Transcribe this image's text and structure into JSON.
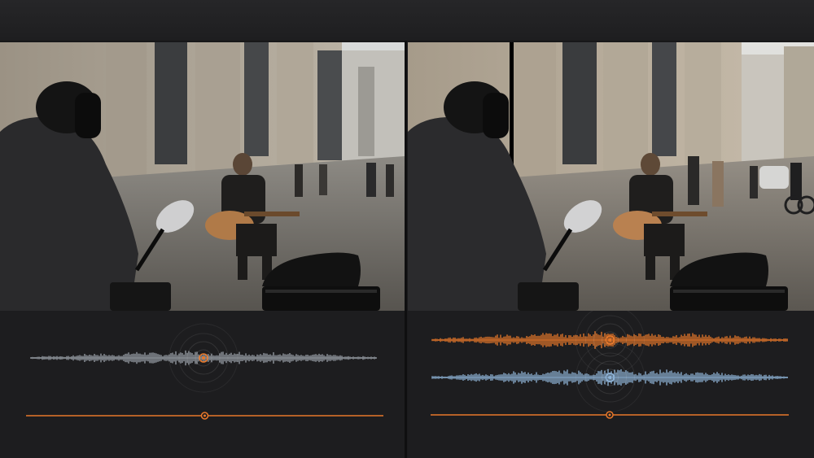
{
  "colors": {
    "background": "#1b1b1d",
    "topbar": "#232325",
    "accent_orange": "#e8782a",
    "wave_grey": "#9aa0a8",
    "wave_blue": "#8fb4d8"
  },
  "panels": [
    {
      "id": "before",
      "preview": "busker-scene-before",
      "tracks": [
        {
          "style": "grey",
          "playhead_fraction": 0.5
        }
      ],
      "timeline_playhead_fraction": 0.5
    },
    {
      "id": "after",
      "preview": "busker-scene-after",
      "tracks": [
        {
          "style": "orange",
          "playhead_fraction": 0.5
        },
        {
          "style": "blue",
          "playhead_fraction": 0.5
        }
      ],
      "timeline_playhead_fraction": 0.5
    }
  ],
  "icons": [
    "playhead-marker-icon",
    "playhead-ring-icon"
  ]
}
